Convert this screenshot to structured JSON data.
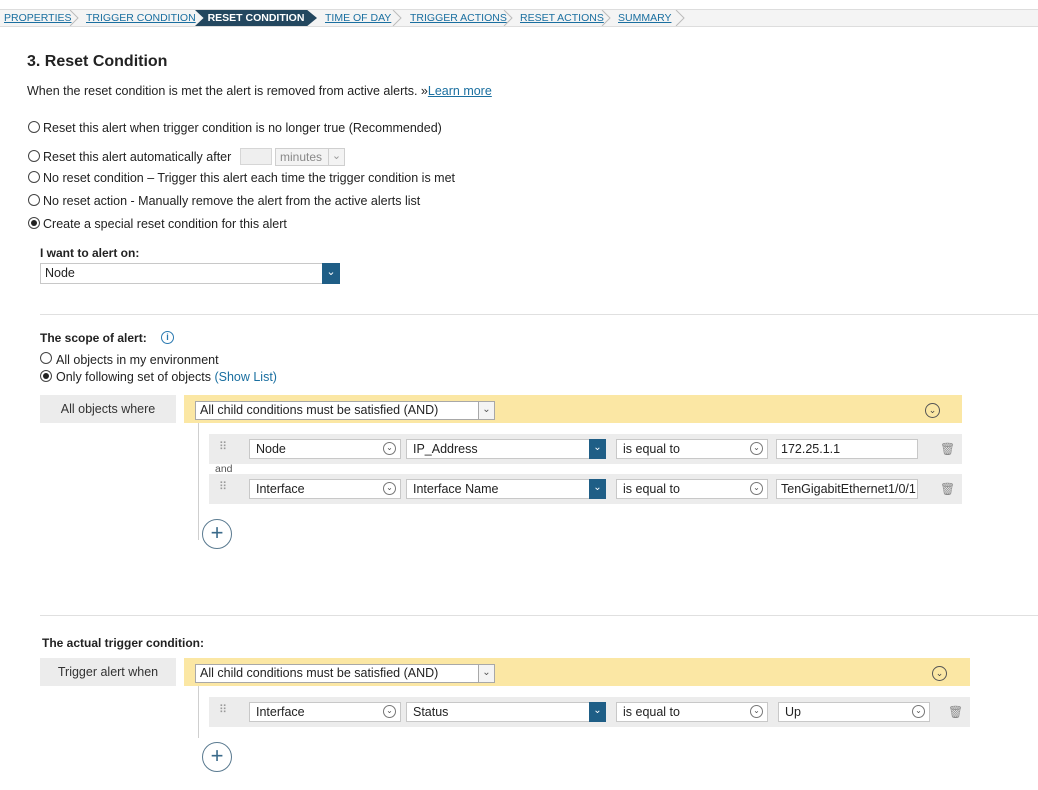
{
  "wizard": {
    "steps": [
      "PROPERTIES",
      "TRIGGER CONDITION",
      "RESET CONDITION",
      "TIME OF DAY",
      "TRIGGER ACTIONS",
      "RESET ACTIONS",
      "SUMMARY"
    ],
    "active_step": "RESET CONDITION"
  },
  "page": {
    "title": "3. Reset Condition",
    "intro": "When the reset condition is met the alert is removed from active alerts. »",
    "learn_more": "Learn more"
  },
  "reset_options": [
    {
      "label": "Reset this alert when trigger condition is no longer true (Recommended)",
      "selected": false
    },
    {
      "label": "Reset this alert automatically after",
      "selected": false,
      "unit": "minutes",
      "value": ""
    },
    {
      "label": "No reset condition – Trigger this alert each time the trigger condition is met",
      "selected": false
    },
    {
      "label": "No reset action - Manually remove the alert from the active alerts list",
      "selected": false
    },
    {
      "label": "Create a special reset condition for this alert",
      "selected": true
    }
  ],
  "alert_on": {
    "label": "I want to alert on:",
    "value": "Node"
  },
  "scope": {
    "label": "The scope of alert:",
    "info_icon": "info-icon",
    "options": [
      {
        "label": "All objects in my environment",
        "selected": false
      },
      {
        "label": "Only following set of objects",
        "selected": true,
        "link": "(Show List)"
      }
    ],
    "where_label": "All objects where",
    "combinator": "All child conditions must be satisfied (AND)",
    "joiner": "and",
    "conditions": [
      {
        "object": "Node",
        "field": "IP_Address",
        "operator": "is equal to",
        "value": "172.25.1.1"
      },
      {
        "object": "Interface",
        "field": "Interface Name",
        "operator": "is equal to",
        "value": "TenGigabitEthernet1/0/1"
      }
    ]
  },
  "trigger": {
    "label": "The actual trigger condition:",
    "when_label": "Trigger alert when",
    "combinator": "All child conditions must be satisfied (AND)",
    "conditions": [
      {
        "object": "Interface",
        "field": "Status",
        "operator": "is equal to",
        "value": "Up"
      }
    ]
  },
  "colors": {
    "link": "#1a6fa0",
    "active_step": "#23475f",
    "yellow_bar": "#fbe7a4",
    "dropdown_button": "#1f5e86"
  }
}
